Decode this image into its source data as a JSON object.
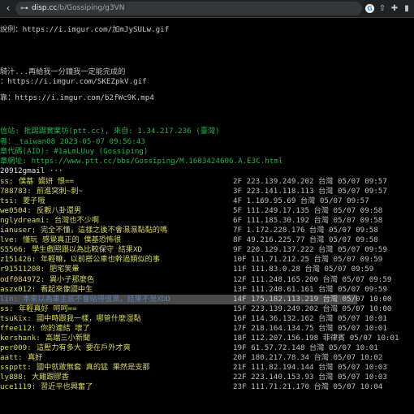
{
  "browser": {
    "url_host": "disp.cc",
    "url_path": "/b/Gossiping/g3VN",
    "back_icon": "arrow-left",
    "forward_icon": "arrow-right",
    "reload_icon": "reload"
  },
  "article": {
    "line1_label": "說例：",
    "line1_url": "https://i.imgur.com/加mJySULw.gif",
    "line2": "騎汁...再給我一分鐘我一定能完成的",
    "line3_label": "：",
    "line3_url": "https://i.imgur.com/SKEZpkV.gif",
    "line4_label": "靠：",
    "line4_url": "https://i.imgur.com/b2fWc9K.mp4"
  },
  "footer": {
    "source": "信站: 批踢踢實業坊(ptt.cc), 來自: 1.34.217.236 (臺灣)",
    "author": "者：_taiwan08 2023-05-07 09:56:43",
    "aid": "章代碼(AID): #1aLmLUuy (Gossiping)",
    "url": "章網址: https://www.ptt.cc/bbs/Gossiping/M.1683424606.A.E3C.html",
    "edit": "20912gmail ···"
  },
  "pushes": [
    {
      "user": "ss:",
      "content": "僕基 嬌妍 恨==",
      "meta": "2F 223.139.249.202 台灣 05/07 09:57"
    },
    {
      "user": "788783:",
      "content": "前進突刺~刺~",
      "meta": "3F 223.141.118.113 台灣 05/07 09:57"
    },
    {
      "user": "tsi:",
      "content": "菱子哦",
      "meta": "4F 1.169.95.69 台灣 05/07 09:57"
    },
    {
      "user": "we0504:",
      "content": "反觀八卦還男",
      "meta": "5F 111.249.17.135 台灣 05/07 09:58"
    },
    {
      "user": "nglydreami:",
      "content": "台灣也不少啊",
      "meta": "6F 111.185.30.192 台灣 05/07 09:58"
    },
    {
      "user": "ianuser:",
      "content": "完全不懂，這樣之後不會濕濕黏黏的嗎",
      "meta": "7F 1.172.228.176 台灣 05/07 09:58"
    },
    {
      "user": "lve:",
      "content": "懂玩 感覺真正的 僕基恐怖很",
      "meta": "8F 49.216.225.77 台灣 05/07 09:58"
    },
    {
      "user": "S5566:",
      "content": "學生戲照跟以為比較保守 結果XD",
      "meta": "9F 220.129.137.222 台灣 05/07 09:59"
    },
    {
      "user": "z151426:",
      "content": "年輕嘛，以前搭公車也幹過類似的事",
      "meta": "10F 111.71.212.25 台灣 05/07 09:59"
    },
    {
      "user": "r91511208:",
      "content": "肥宅笑暈",
      "meta": "11F 111.83.0.28 台灣 05/07 09:59"
    },
    {
      "user": "odf084972:",
      "content": "異小子那麼色",
      "meta": "12F 111.248.165.200 台灣 05/07 09:59"
    },
    {
      "user": "aszx012:",
      "content": "看起來像國中生",
      "meta": "13F 111.240.61.161 台灣 05/07 09:59"
    },
    {
      "user": "lin:",
      "content": "本來以為車主該不會貼得很黑，結果不是XDD",
      "meta": "14F 175.182.113.219 台灣 05/07 10:00"
    },
    {
      "user": "ss:",
      "content": "年輕真好 呵呵==",
      "meta": "15F 223.139.249.202 台灣 05/07 10:00"
    },
    {
      "user": "tsukix:",
      "content": "國中時跟我一樣，哪管什麼湿黏",
      "meta": "16F 114.36.132.162 台灣 05/07 10:01"
    },
    {
      "user": "ffee112:",
      "content": "你的連結 壞了",
      "meta": "17F 218.164.134.75 台灣 05/07 10:01"
    },
    {
      "user": "kershank:",
      "content": "高端三小新聞",
      "meta": "18F 112.207.156.198 菲律賓 05/07 10:01"
    },
    {
      "user": "per009:",
      "content": "這壓力有多大 要在戶外才爽",
      "meta": "19F 61.57.72.148 台灣 05/07 10:01"
    },
    {
      "user": "aatt:",
      "content": "真好",
      "meta": "20F 180.217.78.34 台灣 05/07 10:02"
    },
    {
      "user": "sspptt:",
      "content": "國中就敢無套 真的猛 果然是支那",
      "meta": "21F 111.82.194.144 台灣 05/07 10:03"
    },
    {
      "user": "ly888:",
      "content": "大雞跟膠香",
      "meta": "22F 223.140.153.93 台灣 05/07 10:03"
    },
    {
      "user": "uce1119:",
      "content": "習近平也興奮了",
      "meta": "23F 111.71.21.170 台灣 05/07 10:04"
    }
  ]
}
